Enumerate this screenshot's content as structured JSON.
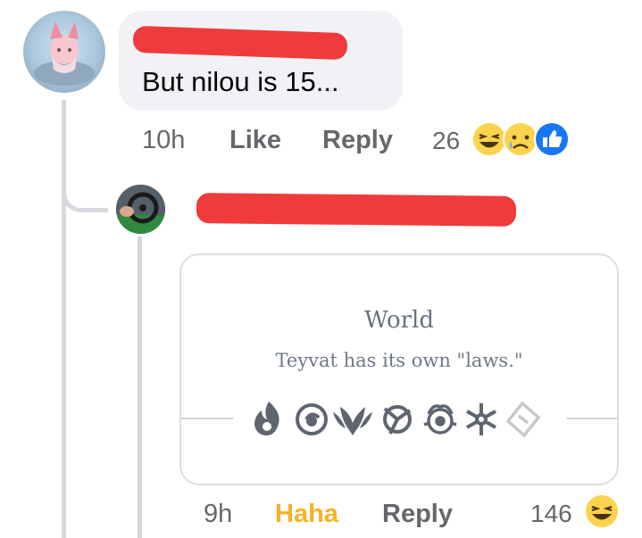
{
  "comment": {
    "text": "But nilou is 15...",
    "time": "10h",
    "like_label": "Like",
    "reply_label": "Reply",
    "reaction_count": "26",
    "reactions": [
      "haha-emoji",
      "sad-emoji",
      "like-emoji"
    ]
  },
  "reply": {
    "card": {
      "title": "World",
      "subtitle": "Teyvat has its own \"laws.\"",
      "elements": [
        "pyro-icon",
        "hydro-icon",
        "anemo-icon",
        "electro-icon",
        "dendro-icon",
        "cryo-icon",
        "geo-icon"
      ]
    },
    "time": "9h",
    "reaction_label": "Haha",
    "reaction_color": "#f7b125",
    "reply_label": "Reply",
    "reaction_count": "146",
    "reactions": [
      "haha-emoji"
    ]
  }
}
